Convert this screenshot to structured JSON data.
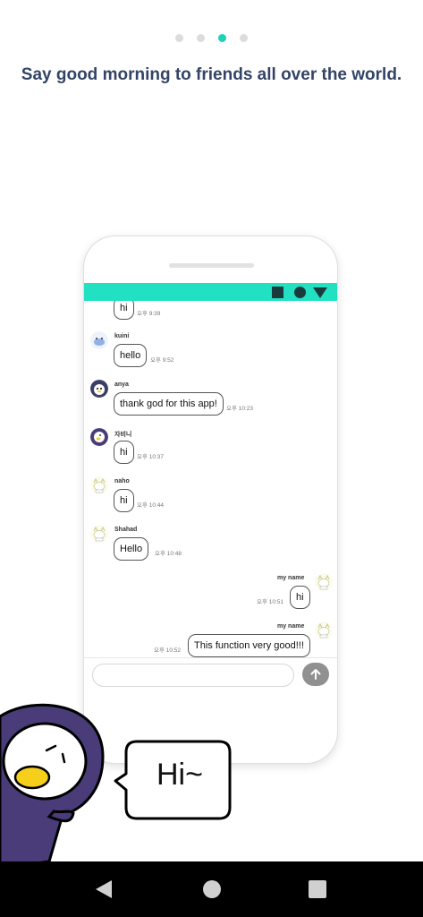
{
  "pager": {
    "count": 4,
    "active_index": 2
  },
  "headline": "Say good morning to friends all over the world.",
  "statusbar": {
    "color": "#22e1c2",
    "icons": [
      "square-icon",
      "circle-icon",
      "triangle-down-icon"
    ]
  },
  "messages": [
    {
      "side": "left",
      "sender": "",
      "text": "hi",
      "time": "오후 9:39"
    },
    {
      "side": "left",
      "sender": "kuini",
      "text": "hello",
      "time": "오후 9:52"
    },
    {
      "side": "left",
      "sender": "anya",
      "text": "thank god for this app!",
      "time": "오후 10:23"
    },
    {
      "side": "left",
      "sender": "자비니",
      "text": "hi",
      "time": "오후 10:37"
    },
    {
      "side": "left",
      "sender": "naho",
      "text": "hi",
      "time": "오후 10:44"
    },
    {
      "side": "left",
      "sender": "Shahad",
      "text": "Hello",
      "time": "오후 10:48"
    },
    {
      "side": "right",
      "sender": "my name",
      "text": "hi",
      "time": "오후 10:51"
    },
    {
      "side": "right",
      "sender": "my name",
      "text": "This function very good!!!",
      "time": "오후 10:52"
    }
  ],
  "input": {
    "placeholder": "",
    "send_icon": "arrow-up-icon"
  },
  "speech_bubble": {
    "text": "Hi~"
  },
  "navbar": {
    "icons": [
      "back-icon",
      "home-icon",
      "recent-apps-icon"
    ]
  },
  "colors": {
    "accent": "#1fd1b5",
    "headline": "#334466",
    "mascot": "#4a3c78",
    "beak": "#f6cf1a"
  }
}
